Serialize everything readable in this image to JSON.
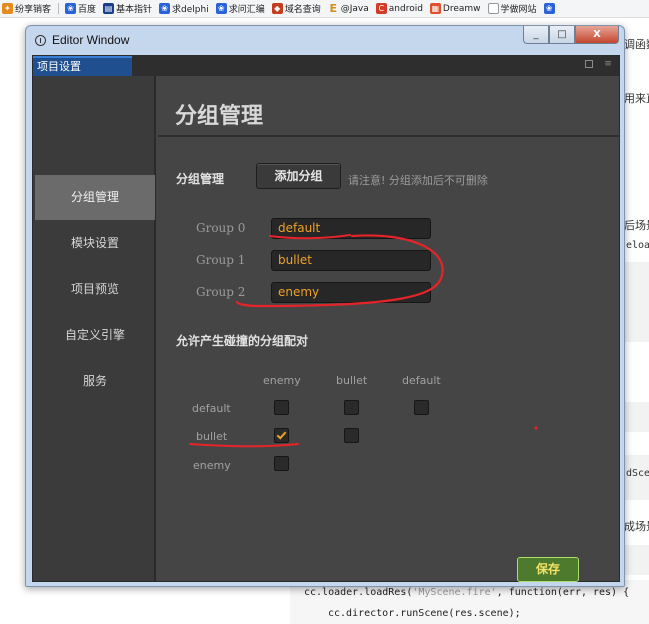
{
  "bookmarks": [
    {
      "label": "纷享销客",
      "icon": "share-icon",
      "color": "#e58a1f"
    },
    {
      "label": "百度",
      "icon": "paw-icon",
      "color": "#2a62d8"
    },
    {
      "label": "基本指针",
      "icon": "book-icon",
      "color": "#1a3f8a"
    },
    {
      "label": "求delphi",
      "icon": "paw-icon",
      "color": "#2a62d8"
    },
    {
      "label": "求问汇编",
      "icon": "paw-icon",
      "color": "#2a62d8"
    },
    {
      "label": "域名查询",
      "icon": "diamond-icon",
      "color": "#c43b1f"
    },
    {
      "label": "@Java",
      "icon": "e-icon",
      "color": "#d68a1a"
    },
    {
      "label": "android",
      "icon": "c-icon",
      "color": "#d23a2a"
    },
    {
      "label": "Dreamw",
      "icon": "puzzle-icon",
      "color": "#e0502a"
    },
    {
      "label": "学做网站",
      "icon": "page-icon",
      "color": "#888888"
    }
  ],
  "background_doc": {
    "frag1": "调函数",
    "frag2": "用来直",
    "frag3": "后场景",
    "frag4": "eloa",
    "frag5": "dSce",
    "frag6": "成场景",
    "code_line1_pre": "cc.loader.loadRes(",
    "code_line1_str": "'MyScene.fire'",
    "code_line1_post": ", function(err, res) {",
    "code_line2": "cc.director.runScene(res.scene);"
  },
  "window": {
    "title": "Editor Window",
    "controls": {
      "minimize": "_",
      "maximize": "□",
      "close": "X"
    }
  },
  "tab": {
    "label": "项目设置"
  },
  "sidebar": {
    "items": [
      {
        "label": "分组管理",
        "active": true
      },
      {
        "label": "模块设置",
        "active": false
      },
      {
        "label": "项目预览",
        "active": false
      },
      {
        "label": "自定义引擎",
        "active": false
      },
      {
        "label": "服务",
        "active": false
      }
    ]
  },
  "main": {
    "title": "分组管理",
    "group_section_label": "分组管理",
    "add_group_button": "添加分组",
    "add_group_note": "请注意! 分组添加后不可删除",
    "groups": [
      {
        "label": "Group 0",
        "value": "default"
      },
      {
        "label": "Group 1",
        "value": "bullet"
      },
      {
        "label": "Group 2",
        "value": "enemy"
      }
    ],
    "collision_title": "允许产生碰撞的分组配对",
    "matrix_cols": [
      "enemy",
      "bullet",
      "default"
    ],
    "matrix_rows": [
      "default",
      "bullet",
      "enemy"
    ],
    "matrix_checked": {
      "default": [
        false,
        false,
        false
      ],
      "bullet": [
        true,
        false
      ],
      "enemy": [
        false
      ]
    },
    "save_button": "保存"
  },
  "colors": {
    "accent_orange": "#f0a12a",
    "annotation_red": "#e5242a",
    "save_green": "#4d7a2c"
  }
}
